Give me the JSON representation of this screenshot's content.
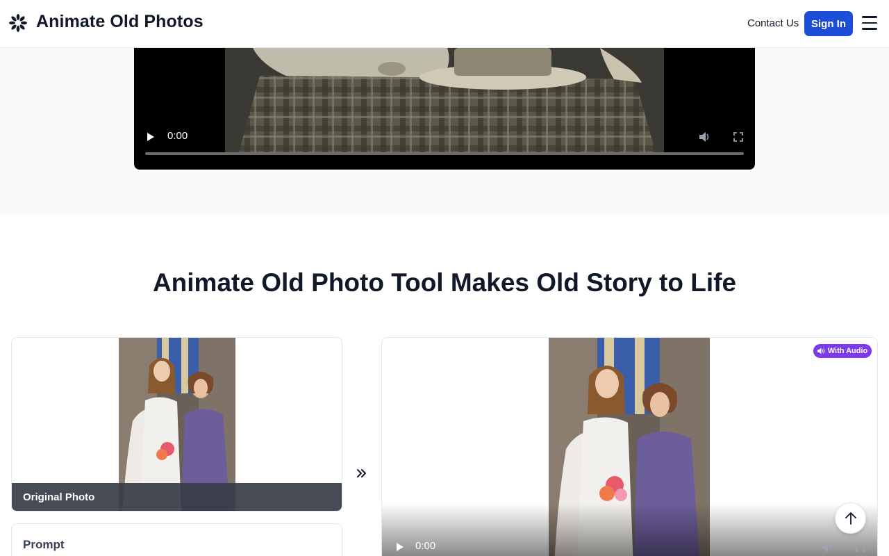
{
  "header": {
    "brand": "Animate Old Photos",
    "contact_label": "Contact Us",
    "signin_label": "Sign In"
  },
  "top_video": {
    "time": "0:00"
  },
  "section": {
    "headline": "Animate Old Photo Tool Makes Old Story to Life"
  },
  "original_card": {
    "label": "Original Photo"
  },
  "prompt_card": {
    "title": "Prompt"
  },
  "result_video": {
    "badge": "With Audio",
    "time": "0:00"
  },
  "colors": {
    "accent": "#1d4ed8",
    "badge": "#7c3aed"
  }
}
